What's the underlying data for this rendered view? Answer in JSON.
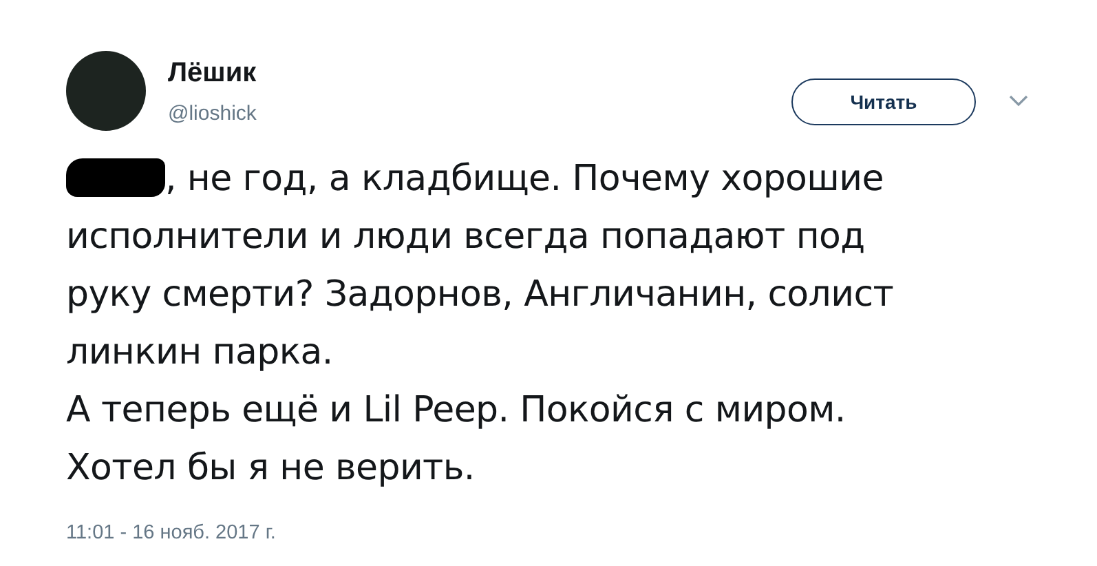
{
  "author": {
    "name": "Лёшик",
    "handle": "@lioshick"
  },
  "follow_button": {
    "label": "Читать"
  },
  "tweet": {
    "redacted_first_word": true,
    "lines": [
      ", не год, а кладбище. Почему хорошие",
      "исполнители и люди всегда попадают под",
      "руку смерти? Задорнов, Англичанин, солист",
      "линкин парка.",
      "А теперь ещё и Lil Peep. Покойся с миром.",
      "Хотел бы я не верить."
    ]
  },
  "timestamp": "11:01 - 16 нояб. 2017 г."
}
